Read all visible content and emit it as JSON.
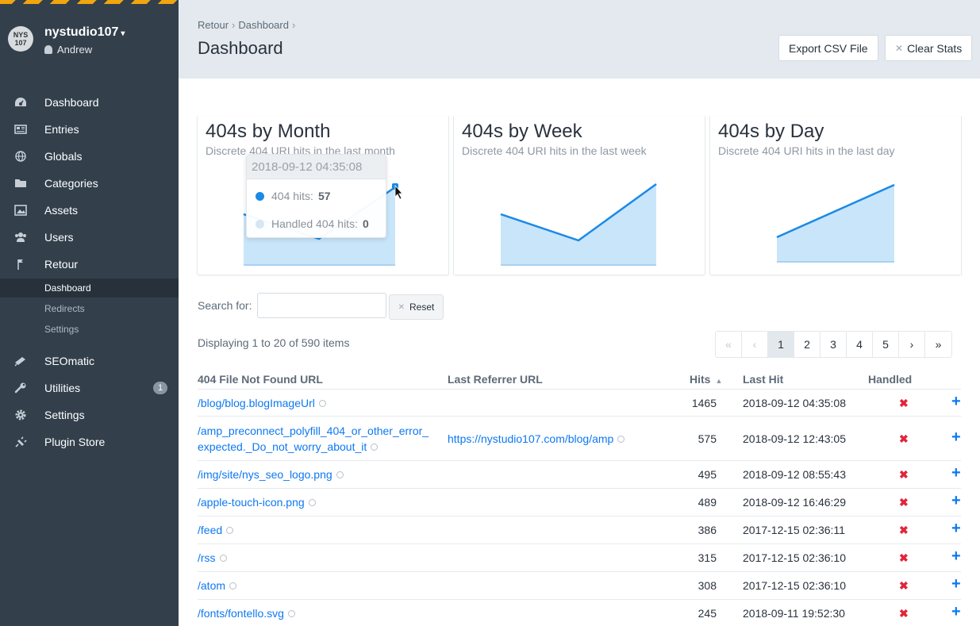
{
  "site": {
    "logo_text": "NYS 107",
    "name": "nystudio107",
    "user": "Andrew"
  },
  "nav": {
    "dashboard": "Dashboard",
    "entries": "Entries",
    "globals": "Globals",
    "categories": "Categories",
    "assets": "Assets",
    "users": "Users",
    "retour": "Retour",
    "retour_sub": [
      "Dashboard",
      "Redirects",
      "Settings"
    ],
    "seomatic": "SEOmatic",
    "utilities": "Utilities",
    "utilities_badge": "1",
    "settings": "Settings",
    "plugin_store": "Plugin Store"
  },
  "header": {
    "breadcrumb": [
      "Retour",
      "Dashboard"
    ],
    "title": "Dashboard",
    "export_label": "Export CSV File",
    "clear_label": "Clear Stats"
  },
  "charts": [
    {
      "title": "404s by Month",
      "subtitle": "Discrete 404 URI hits in the last month"
    },
    {
      "title": "404s by Week",
      "subtitle": "Discrete 404 URI hits in the last week"
    },
    {
      "title": "404s by Day",
      "subtitle": "Discrete 404 URI hits in the last day"
    }
  ],
  "tooltip": {
    "date": "2018-09-12 04:35:08",
    "hits_label": "404 hits:",
    "hits_value": "57",
    "handled_label": "Handled 404 hits:",
    "handled_value": "0"
  },
  "search": {
    "label": "Search for:",
    "value": "",
    "reset_label": "Reset"
  },
  "displaying": "Displaying 1 to 20 of 590 items",
  "pagination": [
    "«",
    "‹",
    "1",
    "2",
    "3",
    "4",
    "5",
    "›",
    "»"
  ],
  "table": {
    "headers": [
      "404 File Not Found URL",
      "Last Referrer URL",
      "Hits",
      "Last Hit",
      "Handled"
    ],
    "rows": [
      {
        "url": "/blog/blog.blogImageUrl",
        "referrer": "",
        "hits": "1465",
        "last_hit": "2018-09-12 04:35:08"
      },
      {
        "url": "/amp_preconnect_polyfill_404_or_other_error_expected._Do_not_worry_about_it",
        "url_line1": "/amp_preconnect_polyfill_404_or_other_error_",
        "url_line2": "expected._Do_not_worry_about_it",
        "referrer": "https://nystudio107.com/blog/amp",
        "hits": "575",
        "last_hit": "2018-09-12 12:43:05"
      },
      {
        "url": "/img/site/nys_seo_logo.png",
        "referrer": "",
        "hits": "495",
        "last_hit": "2018-09-12 08:55:43"
      },
      {
        "url": "/apple-touch-icon.png",
        "referrer": "",
        "hits": "489",
        "last_hit": "2018-09-12 16:46:29"
      },
      {
        "url": "/feed",
        "referrer": "",
        "hits": "386",
        "last_hit": "2017-12-15 02:36:11"
      },
      {
        "url": "/rss",
        "referrer": "",
        "hits": "315",
        "last_hit": "2017-12-15 02:36:10"
      },
      {
        "url": "/atom",
        "referrer": "",
        "hits": "308",
        "last_hit": "2017-12-15 02:36:10"
      },
      {
        "url": "/fonts/fontello.svg",
        "referrer": "",
        "hits": "245",
        "last_hit": "2018-09-11 19:52:30"
      }
    ]
  },
  "colors": {
    "sidebar": "#33404c",
    "link": "#0d78f2",
    "line": "#1a8ae6",
    "area": "#c9e5fa",
    "handled_x": "#e0263a"
  },
  "icons": {
    "handled_false": "✖",
    "add": "+"
  }
}
